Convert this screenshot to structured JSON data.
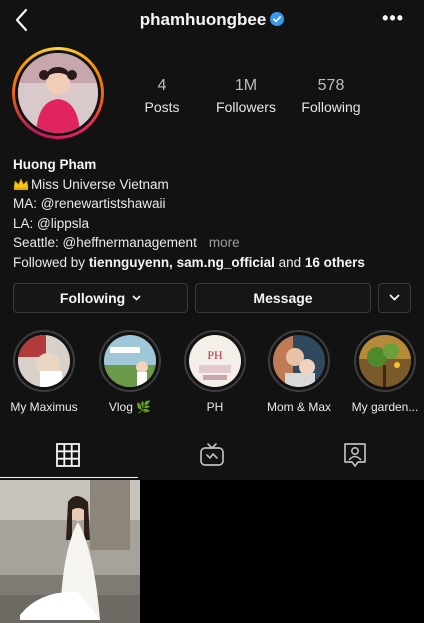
{
  "header": {
    "username": "phamhuongbee",
    "more_icon": "more-dots-icon",
    "verified_color": "#3897f0"
  },
  "stats": {
    "posts": {
      "value": "4",
      "label": "Posts"
    },
    "followers": {
      "value": "1M",
      "label": "Followers"
    },
    "following": {
      "value": "578",
      "label": "Following"
    }
  },
  "bio": {
    "name": "Huong Pham",
    "title": "Miss Universe Vietnam",
    "ma": "MA: @renewartistshawaii",
    "la": "LA: @lippsla",
    "seattle": "Seattle: @heffnermanagement",
    "more": "more",
    "followed_by_prefix": "Followed by",
    "followed_by_names": "tiennguyenn, sam.ng_official",
    "followed_by_and": "and",
    "followed_by_others": "16 others"
  },
  "actions": {
    "following_label": "Following",
    "message_label": "Message"
  },
  "highlights": [
    {
      "label": "My Maximus"
    },
    {
      "label": "Vlog 🌿"
    },
    {
      "label": "PH"
    },
    {
      "label": "Mom & Max"
    },
    {
      "label": "My garden..."
    }
  ],
  "tabs": [
    {
      "icon": "grid-icon",
      "active": true
    },
    {
      "icon": "igtv-icon",
      "active": false
    },
    {
      "icon": "tagged-icon",
      "active": false
    }
  ],
  "posts": [
    {
      "icon": "photo-woman-ao-dai"
    }
  ]
}
